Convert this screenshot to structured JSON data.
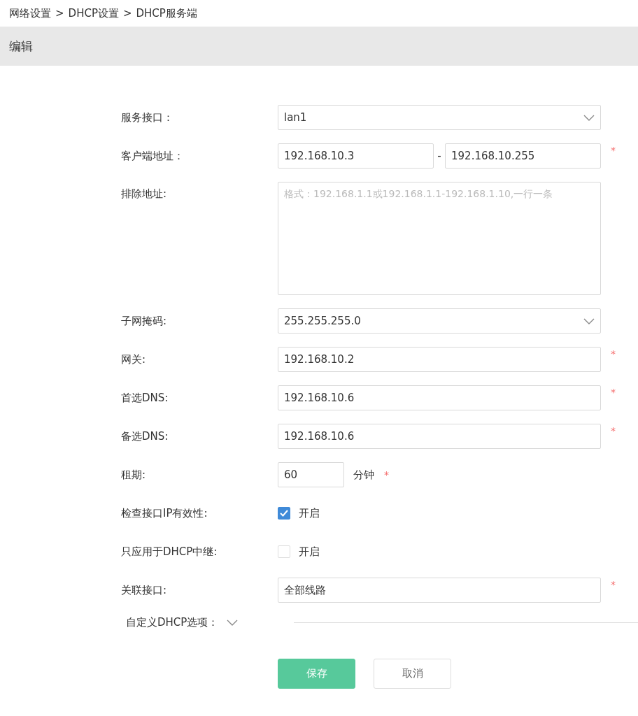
{
  "breadcrumb": [
    "网络设置",
    "DHCP设置",
    "DHCP服务端"
  ],
  "breadcrumb_separator": ">",
  "header": {
    "title": "编辑"
  },
  "fields": [
    {
      "kind": "select",
      "label": "服务接口：",
      "value": "lan1",
      "required": false
    },
    {
      "kind": "range",
      "label": "客户端地址：",
      "from": "192.168.10.3",
      "separator": "-",
      "to": "192.168.10.255",
      "required": true
    },
    {
      "kind": "textarea",
      "label": "排除地址:",
      "placeholder": "格式：192.168.1.1或192.168.1.1-192.168.1.10,一行一条",
      "required": false
    },
    {
      "kind": "select",
      "label": "子网掩码:",
      "value": "255.255.255.0",
      "required": false
    },
    {
      "kind": "text",
      "label": "网关:",
      "value": "192.168.10.2",
      "required": true
    },
    {
      "kind": "text",
      "label": "首选DNS:",
      "value": "192.168.10.6",
      "required": true
    },
    {
      "kind": "text",
      "label": "备选DNS:",
      "value": "192.168.10.6",
      "required": true
    },
    {
      "kind": "unit",
      "label": "租期:",
      "value": "60",
      "unit": "分钟",
      "required": true
    },
    {
      "kind": "checkbox",
      "label": "检查接口IP有效性:",
      "option": "开启",
      "checked": true
    },
    {
      "kind": "checkbox",
      "label": "只应用于DHCP中继:",
      "option": "开启",
      "checked": false
    },
    {
      "kind": "text",
      "label": "关联接口:",
      "value": "全部线路",
      "required": true
    }
  ],
  "custom_options": {
    "label": "自定义DHCP选项：",
    "expanded": false
  },
  "required_mark": "*",
  "buttons": [
    {
      "label": "保存",
      "kind": "primary"
    },
    {
      "label": "取消",
      "kind": "secondary"
    }
  ]
}
